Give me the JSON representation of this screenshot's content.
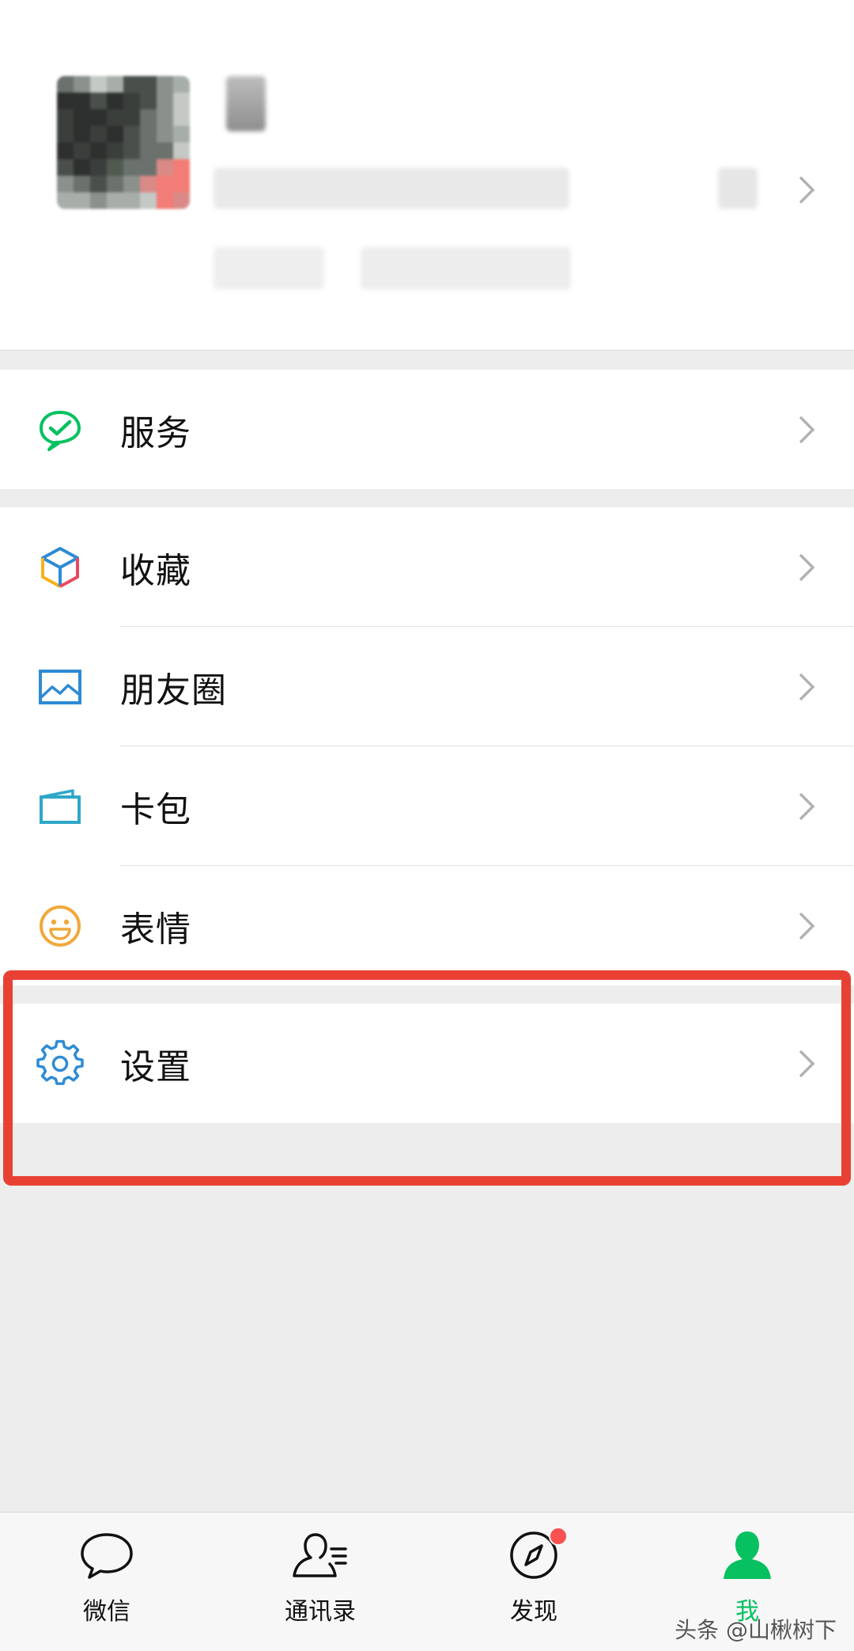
{
  "menu": {
    "services": {
      "label": "服务",
      "icon": "wechat-pay-icon"
    },
    "favorites": {
      "label": "收藏",
      "icon": "cube-icon"
    },
    "moments": {
      "label": "朋友圈",
      "icon": "image-icon"
    },
    "cards": {
      "label": "卡包",
      "icon": "card-icon"
    },
    "stickers": {
      "label": "表情",
      "icon": "smiley-icon"
    },
    "settings": {
      "label": "设置",
      "icon": "gear-icon"
    }
  },
  "tabbar": {
    "chats": {
      "label": "微信",
      "icon": "chat-bubble-icon"
    },
    "contacts": {
      "label": "通讯录",
      "icon": "contacts-icon"
    },
    "discover": {
      "label": "发现",
      "icon": "compass-icon",
      "has_badge": true
    },
    "me": {
      "label": "我",
      "icon": "person-icon",
      "active": true
    }
  },
  "watermark": "头条 @山楸树下",
  "colors": {
    "accent_green": "#07c160",
    "highlight_red": "#e84134",
    "badge_red": "#fa5151",
    "icon_blue": "#2e8bd4"
  }
}
